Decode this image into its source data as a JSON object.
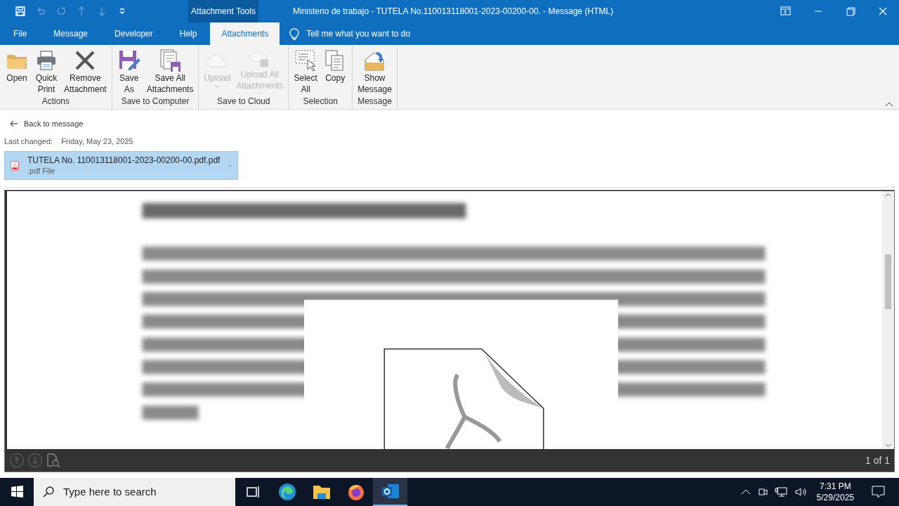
{
  "quick_access": [
    {
      "kind": "save",
      "disabled": false
    },
    {
      "kind": "undo",
      "disabled": true
    },
    {
      "kind": "redo",
      "disabled": true
    },
    {
      "kind": "up",
      "disabled": true
    },
    {
      "kind": "down",
      "disabled": true
    },
    {
      "kind": "customize",
      "disabled": false
    }
  ],
  "context_tab": "Attachment Tools",
  "window": {
    "title": "Ministerio de trabajo - TUTELA No.110013118001-2023-00200-00.  -  Message (HTML)"
  },
  "tabs": [
    {
      "label": "File",
      "selected": false
    },
    {
      "label": "Message",
      "selected": false
    },
    {
      "label": "Developer",
      "selected": false
    },
    {
      "label": "Help",
      "selected": false
    },
    {
      "label": "Attachments",
      "selected": true
    }
  ],
  "tell_me": "Tell me what you want to do",
  "ribbon_groups": [
    {
      "label": "Actions",
      "buttons": [
        {
          "kind": "open",
          "lines": [
            "Open"
          ],
          "disabled": false,
          "dropdown": false
        },
        {
          "kind": "print",
          "lines": [
            "Quick",
            "Print"
          ],
          "disabled": false,
          "dropdown": false
        },
        {
          "kind": "remove",
          "lines": [
            "Remove",
            "Attachment"
          ],
          "disabled": false,
          "dropdown": false
        }
      ]
    },
    {
      "label": "Save to Computer",
      "buttons": [
        {
          "kind": "saveas",
          "lines": [
            "Save",
            "As"
          ],
          "disabled": false,
          "dropdown": false
        },
        {
          "kind": "saveall",
          "lines": [
            "Save All",
            "Attachments"
          ],
          "disabled": false,
          "dropdown": false
        }
      ]
    },
    {
      "label": "Save to Cloud",
      "buttons": [
        {
          "kind": "upload",
          "lines": [
            "Upload"
          ],
          "disabled": true,
          "dropdown": true
        },
        {
          "kind": "uploadall",
          "lines": [
            "Upload All",
            "Attachments"
          ],
          "disabled": true,
          "dropdown": true
        }
      ]
    },
    {
      "label": "Selection",
      "buttons": [
        {
          "kind": "selectall",
          "lines": [
            "Select",
            "All"
          ],
          "disabled": false,
          "dropdown": false
        },
        {
          "kind": "copy",
          "lines": [
            "Copy"
          ],
          "disabled": false,
          "dropdown": false
        }
      ]
    },
    {
      "label": "Message",
      "buttons": [
        {
          "kind": "show",
          "lines": [
            "Show",
            "Message"
          ],
          "disabled": false,
          "dropdown": false
        }
      ]
    }
  ],
  "back_link": "Back to message",
  "last_changed": {
    "label": "Last changed:",
    "value": "Friday, May 23, 2025"
  },
  "attachment": {
    "name": "TUTELA No. 110013118001-2023-00200-00.pdf.pdf",
    "type": ".pdf File",
    "selected": true
  },
  "preview": {
    "kind": "picture",
    "page_counter": "1 of 1"
  },
  "taskbar": {
    "search_placeholder": "Type here to search",
    "apps": [
      {
        "kind": "taskview",
        "selected": false
      },
      {
        "kind": "edge",
        "selected": false
      },
      {
        "kind": "explorer",
        "selected": false
      },
      {
        "kind": "firefox",
        "selected": false
      },
      {
        "kind": "outlook",
        "selected": true
      }
    ],
    "time": "7:31 PM",
    "date": "5/29/2025"
  }
}
